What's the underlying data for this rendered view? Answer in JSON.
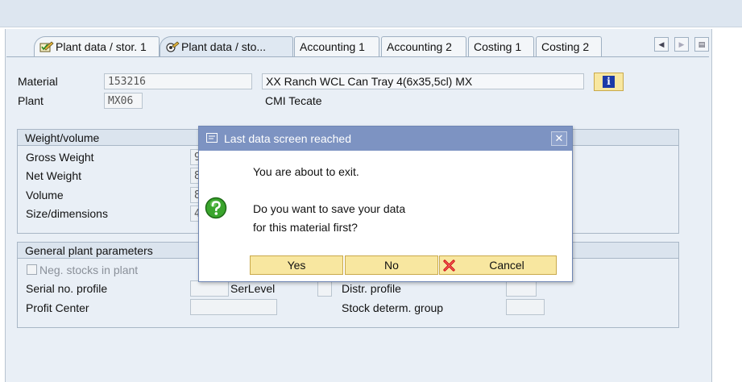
{
  "tabs": [
    {
      "label": "Plant data / stor. 1",
      "icon": "edit-icon"
    },
    {
      "label": "Plant data / sto...",
      "icon": "edit-icon"
    },
    {
      "label": "Accounting 1"
    },
    {
      "label": "Accounting 2"
    },
    {
      "label": "Costing 1"
    },
    {
      "label": "Costing 2"
    }
  ],
  "header": {
    "material_label": "Material",
    "material_value": "153216",
    "material_desc": "XX Ranch WCL Can Tray 4(6x35,5cl) MX",
    "plant_label": "Plant",
    "plant_value": "MX06",
    "plant_desc": "CMI Tecate"
  },
  "weight_group": {
    "title": "Weight/volume",
    "rows": [
      {
        "label": "Gross Weight",
        "value": "9"
      },
      {
        "label": "Net Weight",
        "value": "8"
      },
      {
        "label": "Volume",
        "value": "8"
      },
      {
        "label": "Size/dimensions",
        "value": "4"
      }
    ]
  },
  "plant_group": {
    "title": "General plant parameters",
    "neg_stocks_label": "Neg. stocks in plant",
    "serial_label": "Serial no. profile",
    "serlevel_label": "SerLevel",
    "distr_label": "Distr. profile",
    "profit_label": "Profit Center",
    "stock_label": "Stock determ. group"
  },
  "dialog": {
    "title": "Last data screen reached",
    "line1": "You are about to exit.",
    "line2": "Do you want to save your data",
    "line3": "for this material first?",
    "yes": "Yes",
    "no": "No",
    "cancel": "Cancel"
  },
  "colors": {
    "dialog_title_bg": "#7d93c2",
    "button_bg": "#f8e7a0",
    "question_icon": "#3aa52d",
    "cancel_icon": "#cc1111"
  }
}
